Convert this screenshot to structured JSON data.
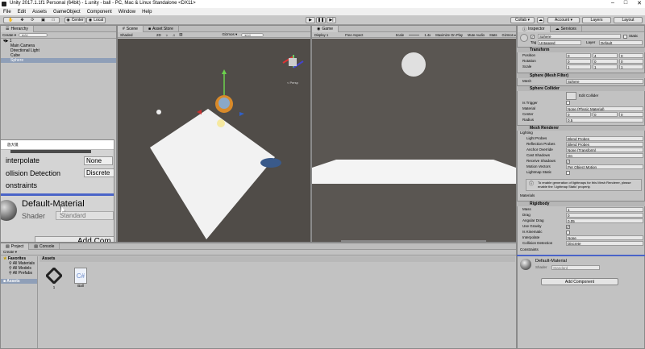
{
  "title": "Unity 2017.1.1f1 Personal (64bit) - 1.unity - ball - PC, Mac & Linux Standalone <DX11>",
  "menu": [
    "File",
    "Edit",
    "Assets",
    "GameObject",
    "Component",
    "Window",
    "Help"
  ],
  "toolbar": {
    "center": "Center",
    "local": "Local",
    "collab": "Collab ▾",
    "account": "Account ▾",
    "layers": "Layers",
    "layout": "Layout"
  },
  "hierarchy": {
    "tab": "Hierarchy",
    "create": "Create ▾",
    "search": "◄All",
    "scene": "1",
    "items": [
      "Main Camera",
      "Directional Light",
      "Cube",
      "Sphere"
    ]
  },
  "scene": {
    "tab": "Scene",
    "asset_tab": "Asset Store",
    "shading": "Shaded",
    "mode": "2D",
    "gizmos": "Gizmos ▾",
    "search": "◄All",
    "persp": "< Persp"
  },
  "game": {
    "tab": "Game",
    "display": "Display 1",
    "aspect": "Free Aspect",
    "scale_label": "Scale",
    "scale": "1.4x",
    "maximize": "Maximize On Play",
    "mute": "Mute Audio",
    "stats": "Stats",
    "gizmos": "Gizmos ▾"
  },
  "overlay": {
    "title": "放大镜",
    "rows": [
      "interpolate",
      "ollision Detection",
      "onstraints"
    ],
    "vals": [
      "None",
      "Discrete"
    ],
    "material": "Default-Material",
    "shader_label": "Shader",
    "shader": "Standard",
    "add": "Add Com"
  },
  "project": {
    "tab": "Project",
    "console_tab": "Console",
    "create": "Create ▾",
    "favorites": "Favorites",
    "fav_items": [
      "All Materials",
      "All Models",
      "All Prefabs"
    ],
    "assets_root": "Assets",
    "assets_header": "Assets",
    "files": [
      {
        "name": "1",
        "icon": "unity-scene-icon"
      },
      {
        "name": "Ball",
        "icon": "csharp-script-icon"
      }
    ]
  },
  "inspector": {
    "tab": "Inspector",
    "services_tab": "Services",
    "object_name": "Sphere",
    "static_label": "Static",
    "tag_label": "Tag",
    "tag": "Untagged",
    "layer_label": "Layer",
    "layer": "Default",
    "transform": {
      "title": "Transform",
      "rows": [
        {
          "label": "Position",
          "x": "0",
          "y": "4",
          "z": "0"
        },
        {
          "label": "Rotation",
          "x": "0",
          "y": "0",
          "z": "0"
        },
        {
          "label": "Scale",
          "x": "1",
          "y": "1",
          "z": "1"
        }
      ]
    },
    "mesh_filter": {
      "title": "Sphere (Mesh Filter)",
      "mesh_label": "Mesh",
      "mesh": "Sphere"
    },
    "collider": {
      "title": "Sphere Collider",
      "edit": "Edit Collider",
      "is_trigger": "Is Trigger",
      "material_label": "Material",
      "material": "None (Physic Material)",
      "center_label": "Center",
      "cx": "0",
      "cy": "0",
      "cz": "0",
      "radius_label": "Radius",
      "radius": "0.5"
    },
    "renderer": {
      "title": "Mesh Renderer",
      "lighting": "Lighting",
      "rows": [
        {
          "label": "Light Probes",
          "value": "Blend Probes"
        },
        {
          "label": "Reflection Probes",
          "value": "Blend Probes"
        },
        {
          "label": "Anchor Override",
          "value": "None (Transform)"
        },
        {
          "label": "Cast Shadows",
          "value": "On"
        },
        {
          "label": "Receive Shadows",
          "value": ""
        },
        {
          "label": "Motion Vectors",
          "value": "Per Object Motion"
        },
        {
          "label": "Lightmap Static",
          "value": ""
        }
      ],
      "info": "To enable generation of lightmaps for this Mesh Renderer, please enable the 'Lightmap Static' property."
    },
    "materials": "Materials",
    "rigidbody": {
      "title": "Rigidbody",
      "rows": [
        {
          "label": "Mass",
          "value": "1"
        },
        {
          "label": "Drag",
          "value": "0"
        },
        {
          "label": "Angular Drag",
          "value": "0.05"
        },
        {
          "label": "Use Gravity",
          "value": "✔"
        },
        {
          "label": "Is Kinematic",
          "value": ""
        },
        {
          "label": "Interpolate",
          "value": "None"
        },
        {
          "label": "Collision Detection",
          "value": "Discrete"
        }
      ],
      "constraints": "Constraints"
    },
    "material": {
      "name": "Default-Material",
      "shader_label": "Shader",
      "shader": "Standard"
    },
    "add_component": "Add Component"
  }
}
